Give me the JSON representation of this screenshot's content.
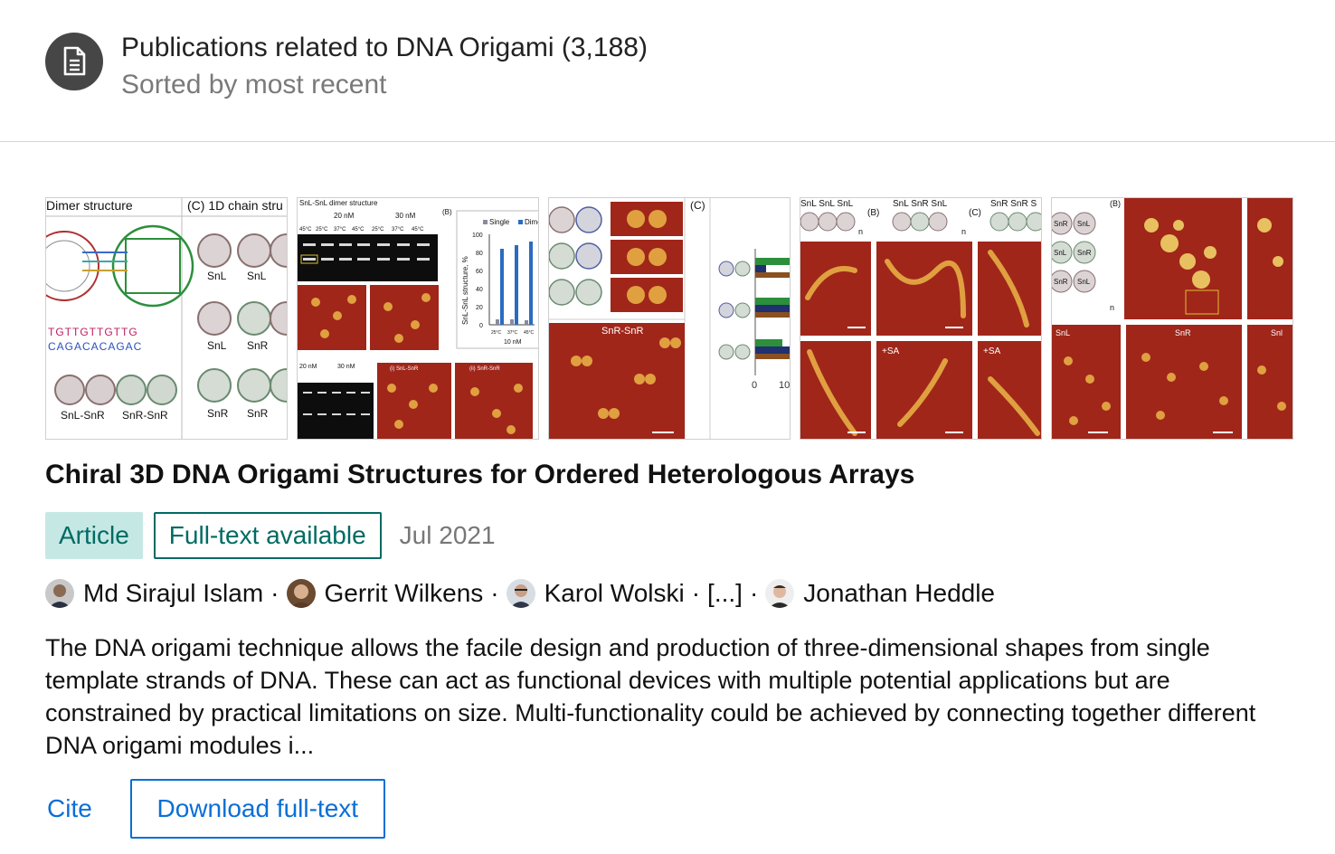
{
  "header": {
    "icon": "document-icon",
    "title": "Publications related to DNA Origami (3,188)",
    "subtitle": "Sorted by most recent"
  },
  "figures": {
    "fig1": {
      "labels": [
        "Dimer structure",
        "(C) 1D chain stru",
        "TGTTGTTGTTG",
        "CAGACACAGAC",
        "SnL",
        "SnL",
        "SnL",
        "SnR",
        "SnR",
        "SnR",
        "SnL-SnR",
        "SnR-SnR"
      ]
    },
    "fig2": {
      "labels": [
        "SnL-SnL dimer structure",
        "20 nM",
        "30 nM",
        "(B)",
        "Single",
        "Dime",
        "SnL-SnL structure, %",
        "10 nM",
        "20 nM",
        "30 nM",
        "(i) SnL-SnR",
        "(ii) SnR-SnR"
      ],
      "temps": [
        "45°C",
        "25°C",
        "37°C",
        "45°C",
        "25°C",
        "37°C",
        "45°C"
      ],
      "y_ticks": [
        "100",
        "80",
        "60",
        "40",
        "20",
        "0"
      ],
      "x_ticks": [
        "25°C",
        "37°C",
        "45°C"
      ]
    },
    "fig3": {
      "labels": [
        "(C)",
        "SnR-SnR",
        "0",
        "10"
      ]
    },
    "fig4": {
      "labels": [
        "SnL SnL SnL",
        "(B)",
        "SnL SnR SnL",
        "(C)",
        "SnR SnR S",
        "n",
        "n",
        "+SA",
        "+SA"
      ]
    },
    "fig5": {
      "labels": [
        "(B)",
        "SnL",
        "SnR",
        "SnL",
        "SnR",
        "SnL",
        "SnR",
        "n",
        "SnL",
        "SnR",
        "Snl"
      ]
    }
  },
  "publication": {
    "title": "Chiral 3D DNA Origami Structures for Ordered Heterologous Arrays",
    "type_badge": "Article",
    "fulltext_badge": "Full-text available",
    "date": "Jul 2021",
    "authors": [
      "Md Sirajul Islam",
      "Gerrit Wilkens",
      "Karol Wolski",
      "[...]",
      "Jonathan Heddle"
    ],
    "author_separator": "·",
    "abstract": "The DNA origami technique allows the facile design and production of three-dimensional shapes from single template strands of DNA. These can act as functional devices with multiple potential applications but are constrained by practical limitations on size. Multi-functionality could be achieved by connecting together different DNA origami modules i...",
    "actions": {
      "cite": "Cite",
      "download": "Download full-text"
    }
  },
  "colors": {
    "teal": "#006b63",
    "teal_bg": "#c6e8e5",
    "link_blue": "#0a6fd6",
    "afm_red": "#a0261a",
    "icon_bg": "#464646"
  }
}
